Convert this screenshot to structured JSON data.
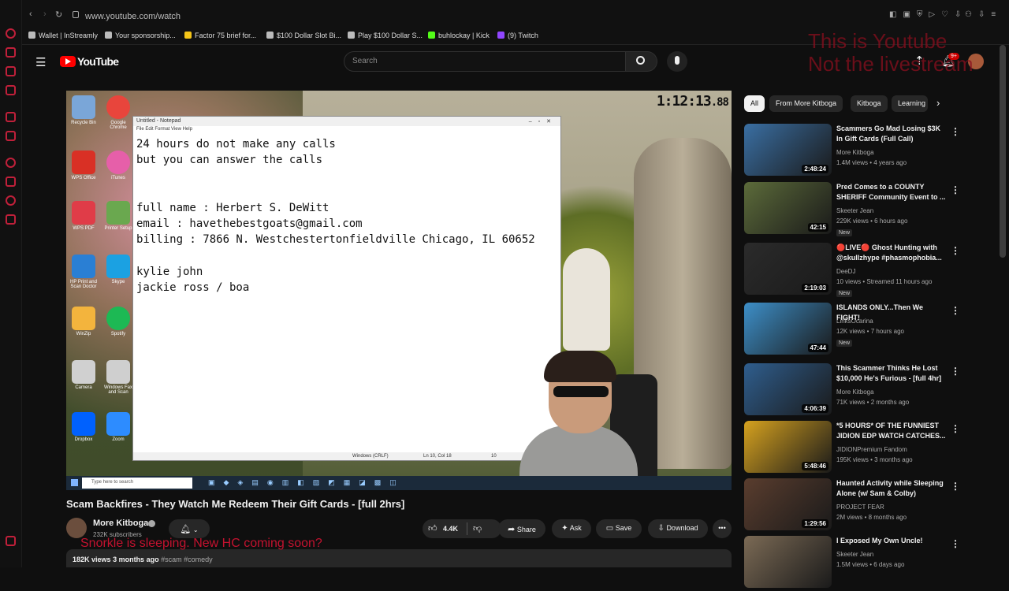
{
  "browser": {
    "url": "www.youtube.com/watch",
    "bookmarks": [
      {
        "label": "Wallet | InStreamly",
        "color": "#bbbbbb"
      },
      {
        "label": "Your sponsorship...",
        "color": "#bbbbbb"
      },
      {
        "label": "Factor 75 brief for...",
        "color": "#f5c518"
      },
      {
        "label": "$100 Dollar Slot Bi...",
        "color": "#bbbbbb"
      },
      {
        "label": "Play $100 Dollar S...",
        "color": "#bbbbbb"
      },
      {
        "label": "buhlockay | Kick",
        "color": "#53fc18"
      },
      {
        "label": "(9) Twitch",
        "color": "#9146ff"
      }
    ]
  },
  "masthead": {
    "logo_text": "YouTube",
    "search_placeholder": "Search",
    "notifications_badge": "9+"
  },
  "video": {
    "timer": "1:12:13",
    "timer_frac": ".88",
    "desktop_icons": [
      {
        "label": "Recycle Bin",
        "color": "#7aa6d8"
      },
      {
        "label": "Google Chrome",
        "color": "#e8453c"
      },
      {
        "label": "WPS Office",
        "color": "#d93025"
      },
      {
        "label": "iTunes",
        "color": "#e65fa9"
      },
      {
        "label": "WPS PDF",
        "color": "#e03c48"
      },
      {
        "label": "Printer Setup",
        "color": "#6aa84f"
      },
      {
        "label": "HP Print and Scan Doctor",
        "color": "#2a7fd4"
      },
      {
        "label": "Skype",
        "color": "#1ba1e2"
      },
      {
        "label": "WinZip",
        "color": "#f3b43d"
      },
      {
        "label": "Spotify",
        "color": "#1db954"
      },
      {
        "label": "Camera",
        "color": "#d0d0d0"
      },
      {
        "label": "Windows Fax and Scan",
        "color": "#cfcfcf"
      },
      {
        "label": "Dropbox",
        "color": "#0061fe"
      },
      {
        "label": "Zoom",
        "color": "#2d8cff"
      }
    ],
    "notepad": {
      "title": "Untitled - Notepad",
      "menu": "File  Edit  Format  View  Help",
      "lines": [
        "24 hours do not make any calls",
        "but you can answer the calls",
        "",
        "",
        "full name : Herbert S. DeWitt",
        "email : havethebestgoats@gmail.com",
        "billing : 7866 N. Westchestertonfieldville Chicago, IL 60652",
        "",
        "kylie john",
        "jackie ross / boa"
      ],
      "status_encoding": "Windows (CRLF)",
      "status_pos": "Ln 10, Col 18",
      "status_zoom": "10"
    },
    "taskbar_search": "Type here to search"
  },
  "watch": {
    "title": "Scam Backfires - They Watch Me Redeem Their Gift Cards - [full 2hrs]",
    "channel": "More Kitboga",
    "subscribers": "232K subscribers",
    "likes": "4.4K",
    "share": "Share",
    "ask": "Ask",
    "save": "Save",
    "download": "Download",
    "overlay": "Snorkle is sleeping. New HC coming soon?",
    "views": "182K views",
    "age": "3 months ago",
    "tags": "#scam #comedy"
  },
  "watermark": "This is Youtube\nNot the livestream",
  "chips": [
    "All",
    "From More Kitboga",
    "Kitboga",
    "Learning"
  ],
  "recommendations": [
    {
      "title": "Scammers Go Mad Losing $3K In Gift Cards (Full Call)",
      "channel": "More Kitboga",
      "meta": "1.4M views • 4 years ago",
      "duration": "2:48:24",
      "new": "",
      "thumb": "#3a6fa3"
    },
    {
      "title": "Pred Comes to a COUNTY SHERIFF Community Event to ...",
      "channel": "Skeeter Jean",
      "meta": "229K views • 6 hours ago",
      "duration": "42:15",
      "new": "New",
      "thumb": "#5c6b3a"
    },
    {
      "title": "🔴LIVE🔴 Ghost Hunting with @skullzhype #phasmophobia...",
      "channel": "DeeDJ",
      "meta": "10 views • Streamed 11 hours ago",
      "duration": "2:19:03",
      "new": "New",
      "thumb": "#2b2b2b"
    },
    {
      "title": "ISLANDS ONLY...Then We FIGHT!",
      "channel": "LinksOcarina",
      "meta": "12K views • 7 hours ago",
      "duration": "47:44",
      "new": "New",
      "thumb": "#3d8fc8"
    },
    {
      "title": "This Scammer Thinks He Lost $10,000 He's Furious - [full 4hr]",
      "channel": "More Kitboga",
      "meta": "71K views • 2 months ago",
      "duration": "4:06:39",
      "new": "",
      "thumb": "#2f5e8e"
    },
    {
      "title": "*5 HOURS* OF THE FUNNIEST JIDION EDP WATCH CATCHES...",
      "channel": "JIDIONPremium Fandom",
      "meta": "195K views • 3 months ago",
      "duration": "5:48:46",
      "new": "",
      "thumb": "#d6a21f"
    },
    {
      "title": "Haunted Activity while Sleeping Alone (w/ Sam & Colby)",
      "channel": "PROJECT FEAR",
      "meta": "2M views • 8 months ago",
      "duration": "1:29:56",
      "new": "",
      "thumb": "#5a3d2e"
    },
    {
      "title": "I Exposed My Own Uncle!",
      "channel": "Skeeter Jean",
      "meta": "1.5M views • 6 days ago",
      "duration": "",
      "new": "",
      "thumb": "#7b6a55"
    }
  ]
}
